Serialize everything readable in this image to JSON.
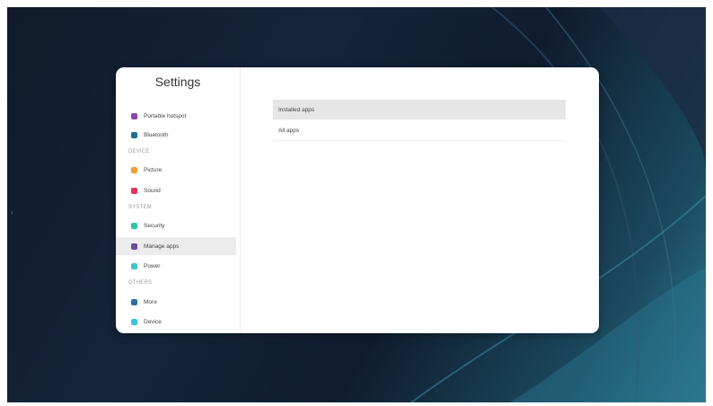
{
  "settings": {
    "title": "Settings",
    "sections": {
      "device": "DEVICE",
      "system": "SYSTEM",
      "others": "OTHERS"
    },
    "items": [
      {
        "label": "Portable hotspot",
        "icon": "hotspot-icon",
        "color": "#8e44ad"
      },
      {
        "label": "Bluetooth",
        "icon": "bluetooth-icon",
        "color": "#1f6f95"
      },
      {
        "label": "Picture",
        "icon": "picture-icon",
        "color": "#f0a230"
      },
      {
        "label": "Sound",
        "icon": "sound-icon",
        "color": "#e0355b"
      },
      {
        "label": "Security",
        "icon": "security-icon",
        "color": "#2ec4a6"
      },
      {
        "label": "Manage apps",
        "icon": "manage-apps-icon",
        "color": "#6b4aa0"
      },
      {
        "label": "Power",
        "icon": "power-icon",
        "color": "#3ec6cf"
      },
      {
        "label": "More",
        "icon": "more-icon",
        "color": "#2a6fa3"
      },
      {
        "label": "Device",
        "icon": "device-icon",
        "color": "#3cc0de"
      }
    ],
    "selected_item": "Manage apps"
  },
  "content": {
    "installed_apps": "Installed apps",
    "all_apps": "All apps"
  }
}
